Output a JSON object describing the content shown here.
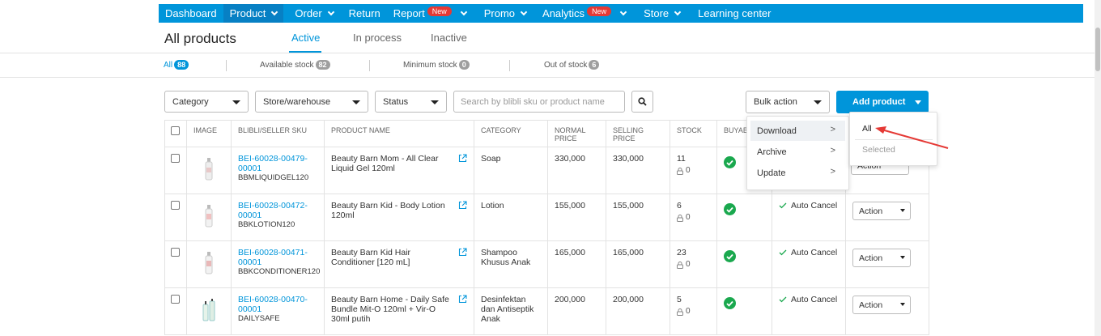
{
  "nav": {
    "items": [
      {
        "label": "Dashboard"
      },
      {
        "label": "Product"
      },
      {
        "label": "Order"
      },
      {
        "label": "Return"
      },
      {
        "label": "Report",
        "badge": "New"
      },
      {
        "label": "Promo"
      },
      {
        "label": "Analytics",
        "badge": "New"
      },
      {
        "label": "Store"
      },
      {
        "label": "Learning center"
      }
    ]
  },
  "page": {
    "title": "All products",
    "tabs": [
      "Active",
      "In process",
      "Inactive"
    ]
  },
  "stock_filters": [
    {
      "label": "All",
      "count": "88"
    },
    {
      "label": "Available stock",
      "count": "82"
    },
    {
      "label": "Minimum stock",
      "count": "0"
    },
    {
      "label": "Out of stock",
      "count": "6"
    }
  ],
  "filters": {
    "category": "Category",
    "store": "Store/warehouse",
    "status": "Status",
    "search_placeholder": "Search by blibli sku or product name",
    "bulk_action": "Bulk action",
    "add_product": "Add product"
  },
  "table": {
    "headers": [
      "IMAGE",
      "BLIBLI/SELLER SKU",
      "PRODUCT NAME",
      "CATEGORY",
      "NORMAL PRICE",
      "SELLING PRICE",
      "STOCK",
      "BUYABL"
    ],
    "rows": [
      {
        "sku": "BEI-60028-00479-00001",
        "seller_sku": "BBMLIQUIDGEL120",
        "name": "Beauty Barn Mom - All Clear Liquid Gel 120ml",
        "category": "Soap",
        "normal_price": "330,000",
        "selling_price": "330,000",
        "stock": "11",
        "locked": "0",
        "status": "",
        "action": ""
      },
      {
        "sku": "BEI-60028-00472-00001",
        "seller_sku": "BBKLOTION120",
        "name": "Beauty Barn Kid - Body Lotion 120ml",
        "category": "Lotion",
        "normal_price": "155,000",
        "selling_price": "155,000",
        "stock": "6",
        "locked": "0",
        "status": "Auto Cancel",
        "action": "Action"
      },
      {
        "sku": "BEI-60028-00471-00001",
        "seller_sku": "BBKCONDITIONER120",
        "name": "Beauty Barn Kid Hair Conditioner [120 mL]",
        "category": "Shampoo Khusus Anak",
        "normal_price": "165,000",
        "selling_price": "165,000",
        "stock": "23",
        "locked": "0",
        "status": "Auto Cancel",
        "action": "Action"
      },
      {
        "sku": "BEI-60028-00470-00001",
        "seller_sku": "DAILYSAFE",
        "name": "Beauty Barn Home - Daily Safe Bundle Mit-O 120ml + Vir-O 30ml putih",
        "category": "Desinfektan dan Antiseptik Anak",
        "normal_price": "200,000",
        "selling_price": "200,000",
        "stock": "5",
        "locked": "0",
        "status": "Auto Cancel",
        "action": "Action"
      }
    ]
  },
  "bulk_menu": {
    "items": [
      "Download",
      "Archive",
      "Update"
    ],
    "submenu": [
      "All",
      "Selected"
    ],
    "partial_action": "Action"
  },
  "colors": {
    "brand": "#0095da",
    "badge": "#e53935",
    "success": "#1aa84e",
    "annotation": "#e53935"
  }
}
